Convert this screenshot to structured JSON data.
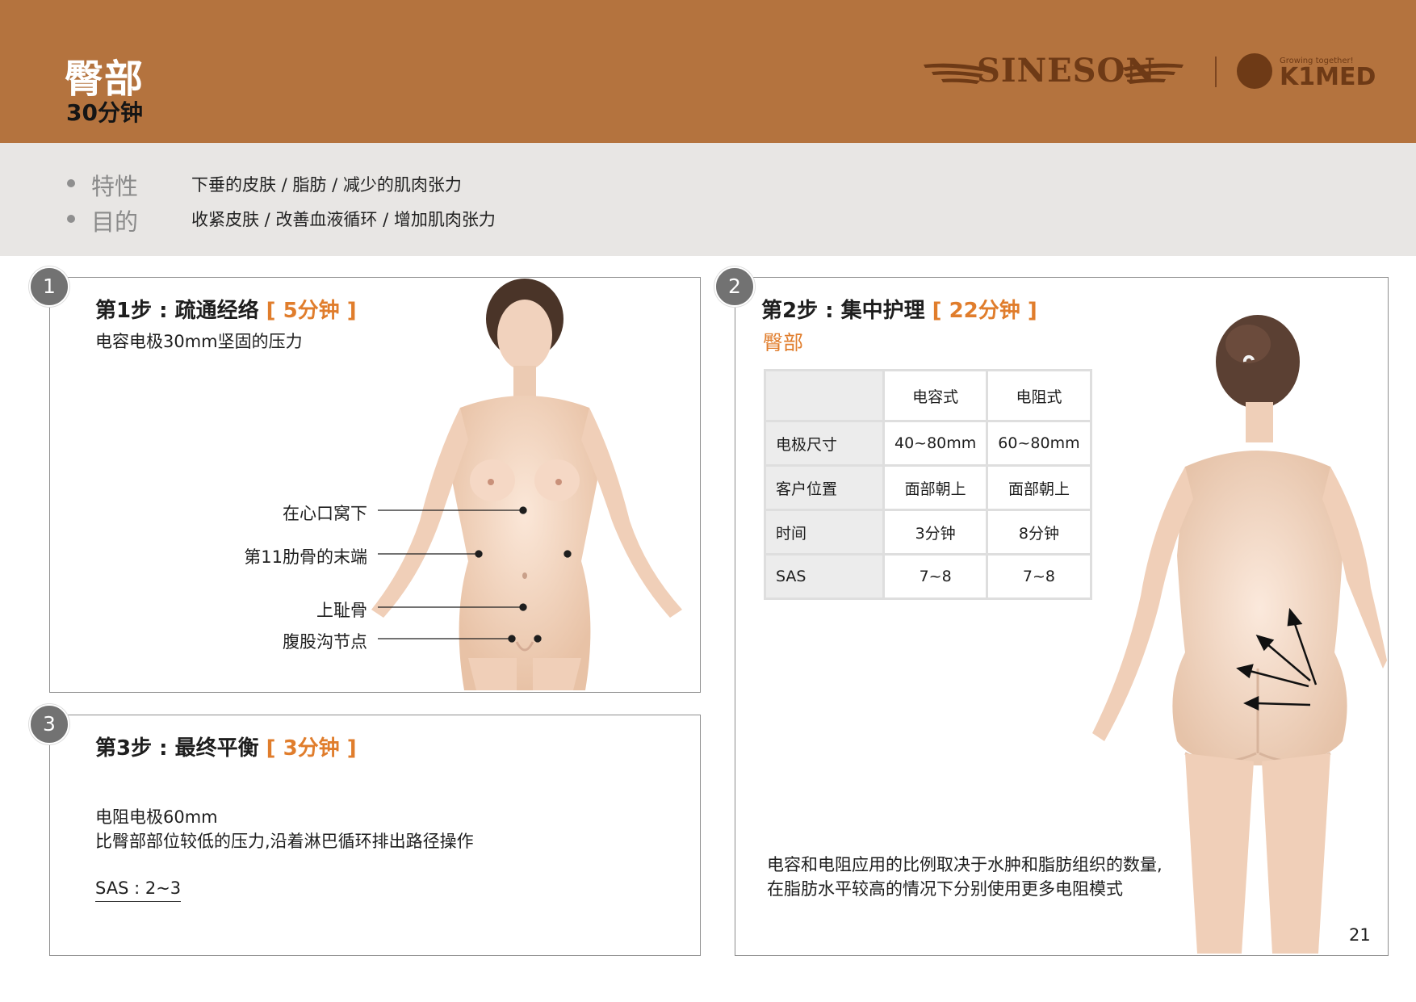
{
  "header": {
    "title": "臀部",
    "duration": "30分钟",
    "brand": "SINESON",
    "partner_tagline": "Growing together!",
    "partner": "K1MED",
    "background_color": "#b4733e"
  },
  "info": {
    "rows": [
      {
        "label": "特性",
        "text": "下垂的皮肤 / 脂肪 / 减少的肌肉张力"
      },
      {
        "label": "目的",
        "text": "收紧皮肤 / 改善血液循环 / 增加肌肉张力"
      }
    ]
  },
  "step1": {
    "number": "1",
    "title": "第1步 : 疏通经络",
    "time": "[ 5分钟 ]",
    "desc": "电容电极30mm坚固的压力",
    "points": [
      "在心口窝下",
      "第11肋骨的末端",
      "上耻骨",
      "腹股沟节点"
    ]
  },
  "step2": {
    "number": "2",
    "title": "第2步 : 集中护理",
    "time": "[ 22分钟 ]",
    "area": "臀部",
    "table": {
      "headers": [
        "",
        "电容式",
        "电阻式"
      ],
      "rows": [
        [
          "电极尺寸",
          "40~80mm",
          "60~80mm"
        ],
        [
          "客户位置",
          "面部朝上",
          "面部朝上"
        ],
        [
          "时间",
          "3分钟",
          "8分钟"
        ],
        [
          "SAS",
          "7~8",
          "7~8"
        ]
      ]
    },
    "note_line1": "电容和电阻应用的比例取决于水肿和脂肪组织的数量,",
    "note_line2": "在脂肪水平较高的情况下分别使用更多电阻模式"
  },
  "step3": {
    "number": "3",
    "title": "第3步 : 最终平衡",
    "time": "[ 3分钟 ]",
    "line1": "电阻电极60mm",
    "line2": "比臀部部位较低的压力,沿着淋巴循环排出路径操作",
    "sas": "SAS : 2~3"
  },
  "page_number": "21",
  "colors": {
    "accent": "#e07d2c",
    "header": "#b4733e",
    "info_band": "#e8e6e4",
    "brand": "#6e3a16"
  }
}
